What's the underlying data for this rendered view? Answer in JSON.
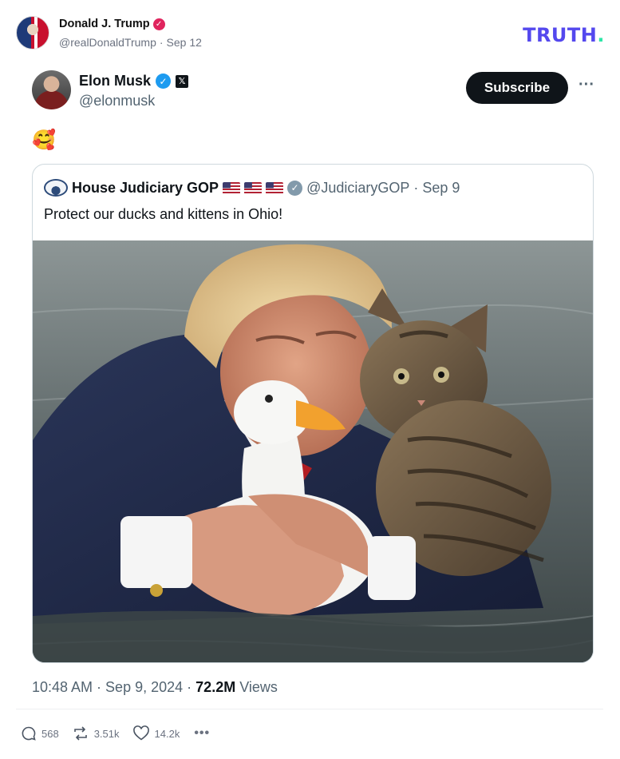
{
  "truth_post": {
    "author_name": "Donald J. Trump",
    "handle": "@realDonaldTrump",
    "date": "Sep 12",
    "separator": "·",
    "logo_text": "TRUTH",
    "logo_dot": "."
  },
  "x_post": {
    "author_name": "Elon Musk",
    "handle": "@elonmusk",
    "badge_text": "𝕏",
    "subscribe_label": "Subscribe",
    "more_label": "•••",
    "body_emoji": "🥰",
    "timestamp": "10:48 AM · Sep 9, 2024",
    "views_count": "72.2M",
    "views_label": "Views",
    "dot": "·"
  },
  "quoted_post": {
    "author_name": "House Judiciary GOP",
    "handle": "@JudiciaryGOP",
    "date": "Sep 9",
    "separator": "·",
    "text": "Protect our ducks and kittens in Ohio!",
    "image_alt_icon": "photo-of-man-hugging-duck-and-kitten"
  },
  "actions": {
    "replies": "568",
    "retruths": "3.51k",
    "likes": "14.2k",
    "more": "•••"
  },
  "colors": {
    "truth_brand": "#5448ee",
    "truth_dot": "#2ee6a8",
    "x_verified": "#1d9bf0",
    "truth_verified": "#e0245e",
    "subscribe_bg": "#0f1419"
  }
}
